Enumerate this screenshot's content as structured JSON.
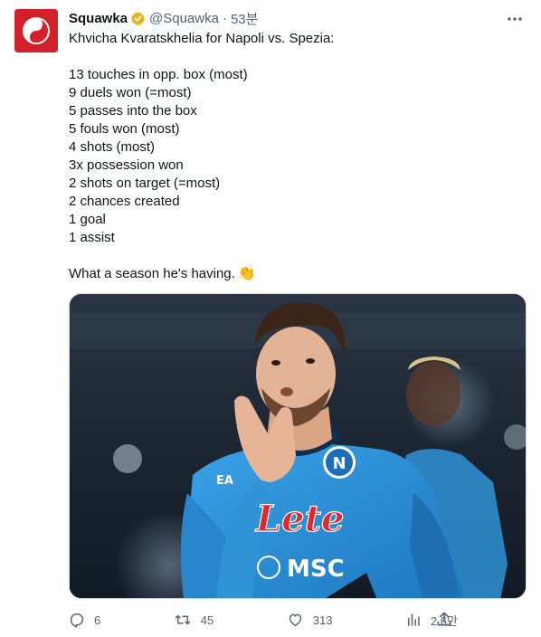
{
  "tweet": {
    "author_name": "Squawka",
    "handle": "@Squawka",
    "separator": "·",
    "time": "53분",
    "lines": [
      "Khvicha Kvaratskhelia for Napoli vs. Spezia:",
      "",
      "13 touches in opp. box (most)",
      "9 duels won (=most)",
      "5 passes into the box",
      "5 fouls won (most)",
      "4 shots (most)",
      "3x possession won",
      "2 shots on target (=most)",
      "2 chances created",
      "1 goal",
      "1 assist",
      ""
    ],
    "closing_text": "What a season he's having.",
    "closing_emoji": "👏"
  },
  "media": {
    "jersey_sponsor": "Lete",
    "jersey_secondary_sponsor": "MSC",
    "kit_maker": "EA",
    "icon": "football-player-photo"
  },
  "actions": {
    "replies": "6",
    "retweets": "45",
    "likes": "313",
    "views": "2.6만"
  },
  "icons": {
    "reply": "reply-icon",
    "retweet": "retweet-icon",
    "like": "heart-icon",
    "views": "views-icon",
    "share": "share-icon",
    "more": "more-icon",
    "verified": "verified-badge-icon"
  },
  "colors": {
    "brand_red": "#d3202a",
    "verified_gold": "#e2b719",
    "secondary_text": "#536471",
    "napoli_blue": "#2f93d6"
  }
}
